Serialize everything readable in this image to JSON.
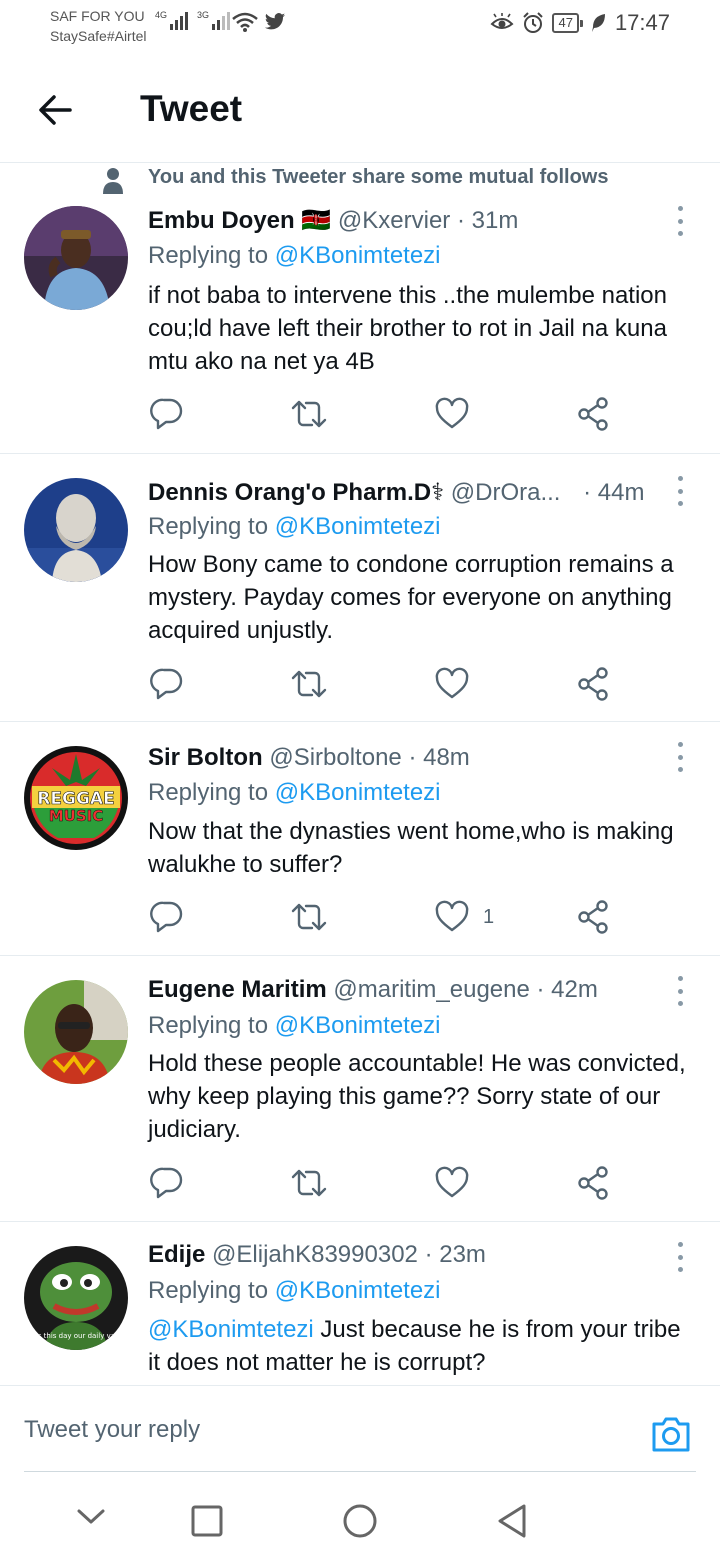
{
  "status_bar": {
    "carrier_line1": "SAF FOR YOU",
    "carrier_line2": "StaySafe#Airtel",
    "network1": "4G",
    "network2": "3G",
    "battery": "47",
    "time": "17:47"
  },
  "header": {
    "title": "Tweet"
  },
  "mutual": {
    "text": "You and this Tweeter share some mutual follows"
  },
  "tweets": [
    {
      "name": "Embu Doyen 🇰🇪",
      "handle": "@Kxervier",
      "time": "· 31m",
      "replying_label": "Replying to ",
      "replying_to": "@KBonimtetezi",
      "text": "if not baba to intervene this ..the mulembe nation cou;ld have left their brother to rot in Jail na kuna mtu ako na net ya 4B",
      "likes": ""
    },
    {
      "name": "Dennis Orang'o Pharm.D⚕",
      "handle": "@DrOra...",
      "time": "· 44m",
      "replying_label": "Replying to ",
      "replying_to": "@KBonimtetezi",
      "text": "How Bony came to condone corruption remains a mystery. Payday comes for everyone on anything acquired unjustly.",
      "likes": ""
    },
    {
      "name": "Sir Bolton",
      "handle": "@Sirboltone",
      "time": "· 48m",
      "replying_label": "Replying to ",
      "replying_to": "@KBonimtetezi",
      "text": "Now that the dynasties went home,who is making walukhe to suffer?",
      "likes": "1"
    },
    {
      "name": "Eugene Maritim",
      "handle": "@maritim_eugene",
      "time": "· 42m",
      "replying_label": "Replying to ",
      "replying_to": "@KBonimtetezi",
      "text": "Hold these people accountable! He was convicted, why keep playing this game?? Sorry state of our judiciary.",
      "likes": ""
    },
    {
      "name": "Edije",
      "handle": "@ElijahK83990302",
      "time": "· 23m",
      "replying_label": "Replying to ",
      "replying_to": "@KBonimtetezi",
      "text_mention": "@KBonimtetezi",
      "text": " Just because he is from your tribe it does not matter he is corrupt?",
      "likes": ""
    }
  ],
  "avatar_text": {
    "reggae_line1": "REGGAE",
    "reggae_line2": "MUSIC",
    "pepe_caption": "e us this day our daily vawu"
  },
  "reply_bar": {
    "placeholder": "Tweet your reply"
  },
  "icons": {
    "back": "arrow-left-icon",
    "more": "more-vertical-icon",
    "reply": "reply-icon",
    "retweet": "retweet-icon",
    "like": "heart-icon",
    "share": "share-icon",
    "camera": "camera-icon"
  },
  "colors": {
    "accent": "#1d9bf0",
    "secondary_text": "#536471",
    "primary_text": "#0f1419"
  }
}
